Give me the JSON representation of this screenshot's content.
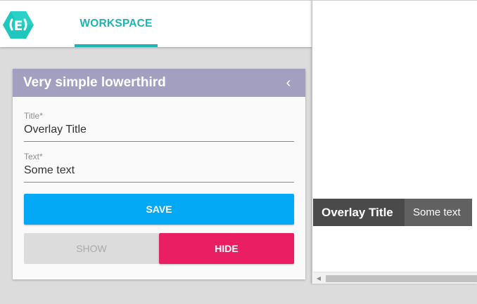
{
  "nav": {
    "logo_icon": "hexagon-logo-icon",
    "tabs": [
      {
        "label": "WORKSPACE",
        "active": true
      }
    ],
    "accent_color": "#1ab5b5"
  },
  "card": {
    "title": "Very simple lowerthird",
    "collapse_icon": "chevron-left-icon",
    "header_color": "#a29fc1",
    "fields": {
      "title": {
        "label": "Title*",
        "value": "Overlay Title"
      },
      "text": {
        "label": "Text*",
        "value": "Some text"
      }
    },
    "buttons": {
      "save": "SAVE",
      "show": "SHOW",
      "hide": "HIDE"
    },
    "colors": {
      "save": "#03a9f4",
      "hide": "#ea1e63",
      "show": "#dcdcdc"
    }
  },
  "preview": {
    "overlay": {
      "title": "Overlay Title",
      "text": "Some text"
    },
    "scroll_left_icon": "scroll-left-arrow-icon"
  }
}
